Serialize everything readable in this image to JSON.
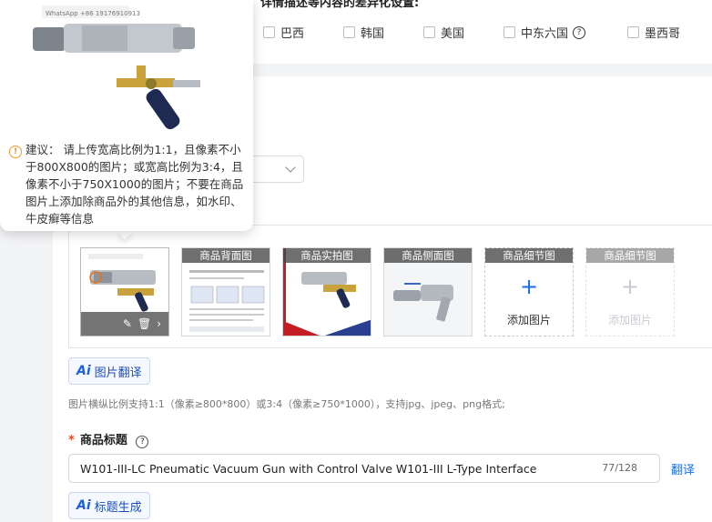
{
  "section": {
    "title": "详情描述等内容的差异化设置:"
  },
  "countries": [
    {
      "label": "巴西"
    },
    {
      "label": "韩国"
    },
    {
      "label": "美国"
    },
    {
      "label": "中东六国"
    },
    {
      "label": "墨西哥"
    }
  ],
  "image_slots": [
    {
      "label": "",
      "kind": "product-photo",
      "selected": true
    },
    {
      "label": "商品背面图",
      "kind": "document"
    },
    {
      "label": "商品实拍图",
      "kind": "product-photo-red"
    },
    {
      "label": "商品侧面图",
      "kind": "side-photo"
    },
    {
      "label": "商品细节图",
      "add_label": "添加图片",
      "kind": "add"
    },
    {
      "label": "商品细节图",
      "add_label": "添加图片",
      "kind": "add-disabled"
    }
  ],
  "image_translate": {
    "ai_mark": "Ai",
    "label": "图片翻译"
  },
  "image_hint": "图片横纵比例支持1:1（像素≥800*800）或3:4（像素≥750*1000），支持jpg、jpeg、png格式;",
  "product_title": {
    "required_mark": "*",
    "label": "商品标题",
    "value": "W101-III-LC Pneumatic Vacuum Gun with Control Valve W101-III L-Type Interface",
    "counter": "77/128",
    "translate": "翻译"
  },
  "title_generate": {
    "ai_mark": "Ai",
    "label": "标题生成"
  },
  "popover": {
    "watermark": "WhatsApp +86 19176910913",
    "suggestion": "建议：  请上传宽高比例为1:1，且像素不小于800X800的图片；或宽高比例为3:4，且像素不小于750X1000的图片；不要在商品图片上添加除商品外的其他信息，如水印、牛皮癣等信息"
  },
  "icons": {
    "help": "question-circle-icon",
    "warning": "warning-circle-icon",
    "edit": "pencil-icon",
    "delete": "trash-icon",
    "next": "chevron-right-icon",
    "add": "plus-icon",
    "dropdown": "chevron-down-icon"
  },
  "colors": {
    "accent": "#1c6ee8",
    "required": "#e34b2b",
    "warning": "#e89a2c"
  }
}
